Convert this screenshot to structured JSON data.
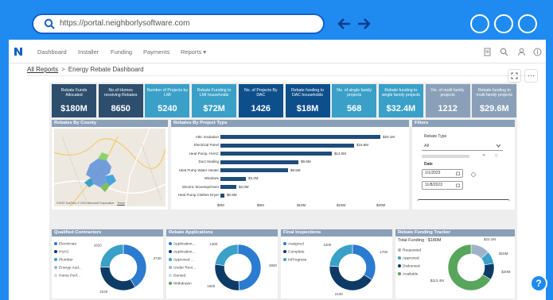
{
  "browser": {
    "url": "https://portal.neighborlysoftware.com"
  },
  "nav": {
    "items": [
      "Dashboard",
      "Installer",
      "Funding",
      "Payments",
      "Reports ▾"
    ]
  },
  "breadcrumb": {
    "root": "All Reports",
    "separator": ">",
    "current": "Energy Rebate Dashboard"
  },
  "kpis": [
    {
      "label": "Rebate Funds Allocated",
      "value": "$180M",
      "color": "#2e4e6e"
    },
    {
      "label": "No.of Homes receiving Rebates",
      "value": "8650",
      "color": "#2e4e6e"
    },
    {
      "label": "Number of Projects by LMI",
      "value": "5240",
      "color": "#3aa0c8"
    },
    {
      "label": "Rebate Funding to LMI households",
      "value": "$72M",
      "color": "#3aa0c8"
    },
    {
      "label": "No. of Projects By DAC",
      "value": "1426",
      "color": "#0d4f8b"
    },
    {
      "label": "Rebate funding to DAC households",
      "value": "$18M",
      "color": "#0d4f8b"
    },
    {
      "label": "No. of single family projects",
      "value": "568",
      "color": "#3aa0c8"
    },
    {
      "label": "Rebate funding to single family projects",
      "value": "$32.4M",
      "color": "#3aa0c8"
    },
    {
      "label": "No. of multi family projects",
      "value": "1212",
      "color": "#8aa0b8"
    },
    {
      "label": "Rebate funding to multi family projects",
      "value": "$29.6M",
      "color": "#8aa0b8"
    }
  ],
  "map": {
    "title": "Rebates By County",
    "attribution": "©2023 TomTom, © 2023 Microsoft Corporation",
    "terms": "Terms"
  },
  "chart_data": [
    {
      "type": "bar",
      "title": "Rebates By Project Type",
      "orientation": "horizontal",
      "categories": [
        "Attic Insulation",
        "Electrical Panel",
        "Heat Pump, HVAC",
        "Duct Sealing",
        "Heat Pump Water Heater",
        "Windows",
        "Electric Stovetop/Oven",
        "Heat Pump Clothes Dryer"
      ],
      "values": [
        20.1,
        16.8,
        14.0,
        9.8,
        8.5,
        3.2,
        2.0,
        0.5
      ],
      "value_labels": [
        "$20.1M",
        "$16.8M",
        "$14.0M",
        "$9.8M",
        "$8.5M",
        "$3.2M",
        "$2.0M",
        "$0.5M"
      ],
      "xticks": [
        "$0M",
        "$5M",
        "$10M",
        "$15M",
        "$20M"
      ],
      "xlim": [
        0,
        20
      ],
      "color": "#1e4d7b"
    },
    {
      "type": "pie",
      "title": "Qualified Contractors",
      "legend": [
        "Electrician",
        "HVAC",
        "Plumber",
        "Energy Aud...",
        "Home Perf..."
      ],
      "colors": [
        "#2b7bd0",
        "#0d3b66",
        "#3aa0c8",
        "#9fb3c8",
        "#cfd8e3"
      ],
      "values": [
        2730,
        2240,
        1620,
        0,
        0
      ],
      "labels": [
        "2730",
        "2240",
        "1620"
      ]
    },
    {
      "type": "pie",
      "title": "Rebate Applications",
      "legend": [
        "Application...",
        "Application...",
        "Approved ...",
        "Under Revi...",
        "Denied",
        "Withdrawn"
      ],
      "colors": [
        "#2b7bd0",
        "#0d3b66",
        "#3aa0c8",
        "#9fb3c8",
        "#cfd8e3",
        "#58a55c"
      ],
      "values": [
        2800,
        1600,
        1300,
        0,
        0,
        0
      ],
      "labels": [
        "2800",
        "1600",
        "1300"
      ]
    },
    {
      "type": "pie",
      "title": "Final Inspections",
      "legend": [
        "Assigned",
        "Complete",
        "InProgress"
      ],
      "colors": [
        "#2b7bd0",
        "#0d3b66",
        "#3aa0c8"
      ],
      "values": [
        1700,
        2100,
        1200
      ],
      "labels": [
        "1700",
        "2100",
        "1200"
      ]
    },
    {
      "type": "pie",
      "title": "Rebate Funding Tracker",
      "legend": [
        "Requested",
        "Approved",
        "Disbursed",
        "Available"
      ],
      "colors": [
        "#9fb3c8",
        "#3aa0c8",
        "#0d3b66",
        "#58a55c"
      ],
      "values": [
        23,
        15,
        20,
        113.4
      ],
      "labels": [
        "$23.1M",
        "$15M",
        "$20M",
        "$113.4M"
      ]
    }
  ],
  "filters": {
    "title": "Filters",
    "rebate_type_label": "Rebate Type",
    "rebate_type_value": "All",
    "date_label": "Date",
    "date_from": "1/1/2023",
    "date_to": "11/8/2023"
  },
  "funding_tracker": {
    "total_label": "Total Funding :",
    "total_value": "$180M"
  }
}
